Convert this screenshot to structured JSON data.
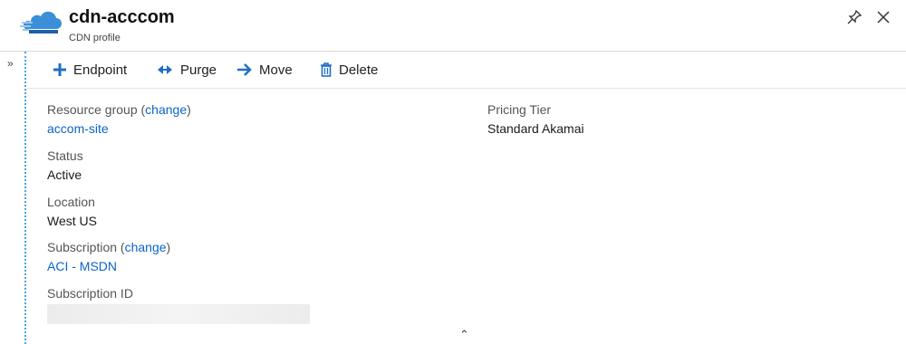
{
  "header": {
    "title": "cdn-acccom",
    "subtitle": "CDN profile",
    "logo_icon": "cdn-cloud-icon",
    "pin_icon": "pin-icon",
    "close_icon": "close-icon"
  },
  "sidebar": {
    "expand_glyph": "»"
  },
  "toolbar": {
    "endpoint_label": "Endpoint",
    "purge_label": "Purge",
    "move_label": "Move",
    "delete_label": "Delete"
  },
  "essentials": {
    "resource_group": {
      "label_prefix": "Resource group (",
      "change_label": "change",
      "label_suffix": ")",
      "value": "accom-site"
    },
    "status": {
      "label": "Status",
      "value": "Active"
    },
    "location": {
      "label": "Location",
      "value": "West US"
    },
    "subscription": {
      "label_prefix": "Subscription (",
      "change_label": "change",
      "label_suffix": ")",
      "value": "ACI - MSDN"
    },
    "subscription_id": {
      "label": "Subscription ID"
    },
    "pricing_tier": {
      "label": "Pricing Tier",
      "value": "Standard Akamai"
    }
  },
  "footer": {
    "collapse_glyph": "⌃"
  },
  "colors": {
    "accent": "#0a64c8",
    "icon_blue": "#1f6fc5"
  }
}
